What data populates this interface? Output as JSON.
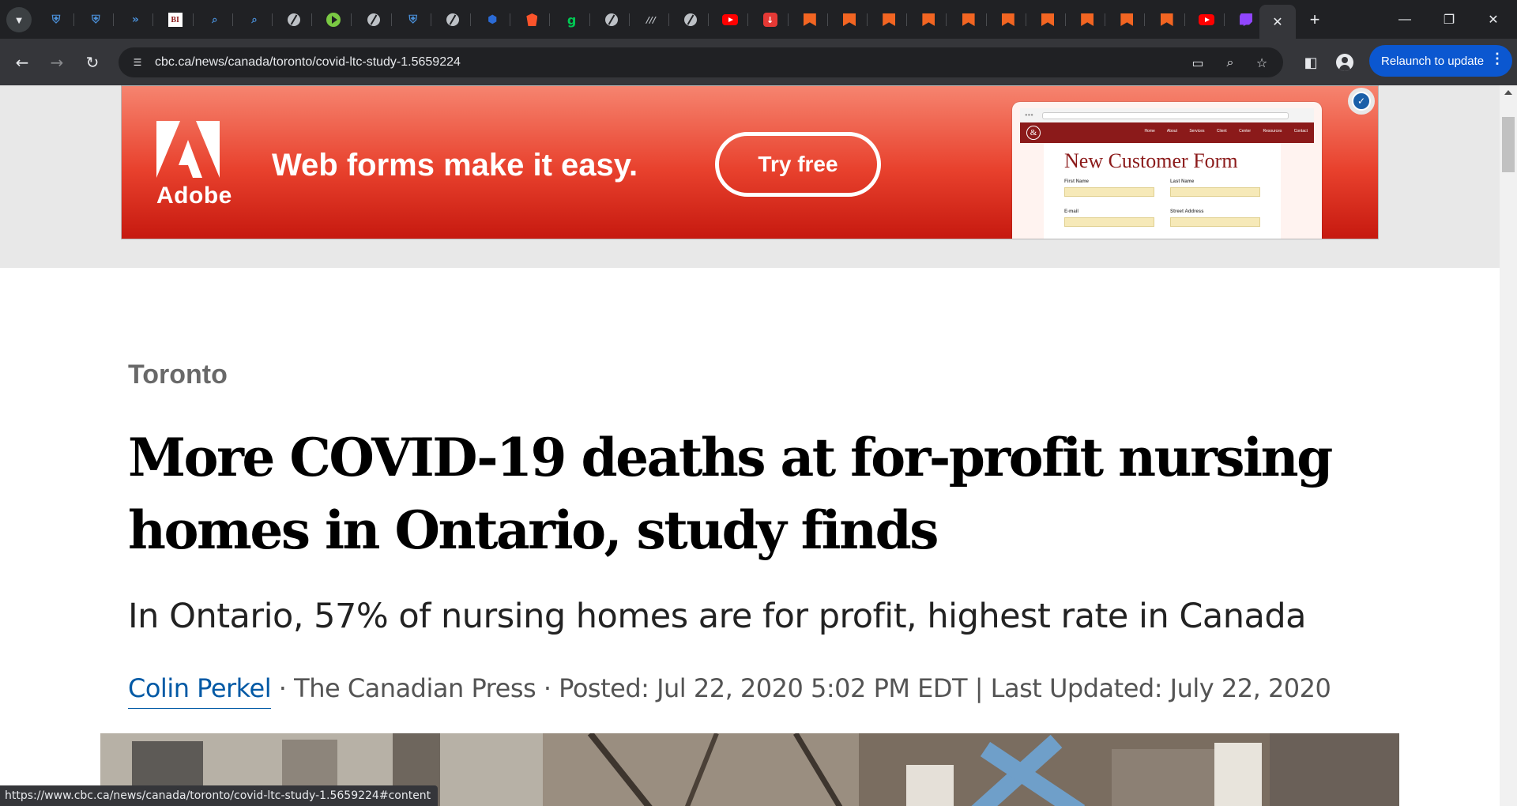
{
  "browser": {
    "tabs": [
      {
        "icon": "shield-icon"
      },
      {
        "icon": "shield-icon"
      },
      {
        "icon": "arrows-icon"
      },
      {
        "icon": "bi-logo-icon",
        "glyph": "BI"
      },
      {
        "icon": "search-icon"
      },
      {
        "icon": "search-icon"
      },
      {
        "icon": "globe-icon"
      },
      {
        "icon": "play-icon"
      },
      {
        "icon": "globe-icon"
      },
      {
        "icon": "shield-icon"
      },
      {
        "icon": "globe-icon"
      },
      {
        "icon": "hex-icon"
      },
      {
        "icon": "brave-icon"
      },
      {
        "icon": "g-logo-icon",
        "glyph": "g"
      },
      {
        "icon": "globe-icon"
      },
      {
        "icon": "slash-icon",
        "glyph": "///"
      },
      {
        "icon": "globe-icon"
      },
      {
        "icon": "youtube-icon"
      },
      {
        "icon": "podcast-icon"
      },
      {
        "icon": "bookmark-icon"
      },
      {
        "icon": "bookmark-icon"
      },
      {
        "icon": "bookmark-icon"
      },
      {
        "icon": "bookmark-icon"
      },
      {
        "icon": "bookmark-icon"
      },
      {
        "icon": "bookmark-icon"
      },
      {
        "icon": "bookmark-icon"
      },
      {
        "icon": "bookmark-icon"
      },
      {
        "icon": "bookmark-icon"
      },
      {
        "icon": "bookmark-icon"
      },
      {
        "icon": "youtube-icon"
      },
      {
        "icon": "twitch-icon"
      }
    ],
    "url": "cbc.ca/news/canada/toronto/covid-ltc-study-1.5659224",
    "relaunch_label": "Relaunch to update",
    "status_url": "https://www.cbc.ca/news/canada/toronto/covid-ltc-study-1.5659224#content"
  },
  "ad": {
    "brand": "Adobe",
    "headline": "Web forms make it easy.",
    "cta": "Try free",
    "form_title": "New Customer Form",
    "form_labels": [
      "First Name",
      "Last Name",
      "E-mail",
      "Street Address"
    ],
    "form_nav": "Home  About  Services  Client Center  Resources  Contact"
  },
  "article": {
    "section": "Toronto",
    "headline": "More COVID-19 deaths at for-profit nursing homes in Ontario, study finds",
    "dek": "In Ontario, 57% of nursing homes are for profit, highest rate in Canada",
    "author": "Colin Perkel",
    "source": "The Canadian Press",
    "posted": "Posted: Jul 22, 2020 5:02 PM EDT",
    "updated": "Last Updated: July 22, 2020"
  },
  "colors": {
    "chrome_dark": "#202124",
    "toolbar": "#35363a",
    "relaunch_blue": "#0b57d0",
    "adobe_red": "#e8412d",
    "cbc_link_blue": "#0059a5"
  }
}
